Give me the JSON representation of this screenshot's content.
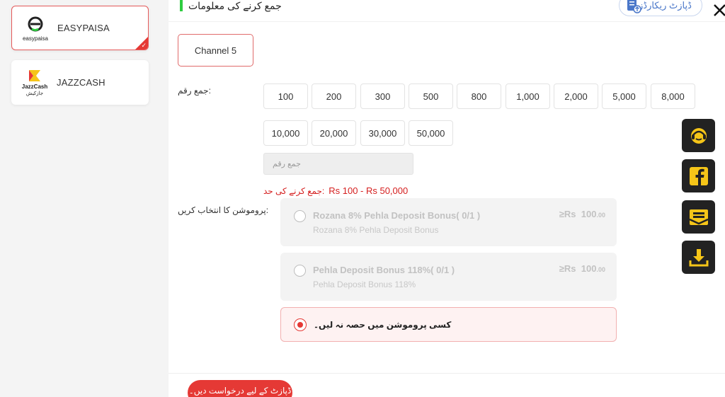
{
  "payment_methods": [
    {
      "name": "EASYPAISA",
      "logo_text": "easypaisa",
      "selected": true
    },
    {
      "name": "JAZZCASH",
      "logo_text": "JazzCash",
      "logo_subtext": "جازکیش",
      "selected": false
    }
  ],
  "header": {
    "title": "جمع کرنے کی معلومات",
    "accent_color": "#2ecc40"
  },
  "record_button": {
    "label": "ڈپازٹ ریکارڈز",
    "icon": "document-icon"
  },
  "close_icon": "close-icon",
  "channel": {
    "label": "Channel 5"
  },
  "amount": {
    "label": "جمع رقم:",
    "presets": [
      "100",
      "200",
      "300",
      "500",
      "800",
      "1,000",
      "2,000",
      "5,000",
      "8,000",
      "10,000",
      "20,000",
      "30,000",
      "50,000"
    ],
    "input_placeholder": "جمع رقم",
    "limit_label": "جمع کرنے کی حد:",
    "limit_value": "Rs  100  -  Rs  50,000"
  },
  "promotion": {
    "label": "پروموشن کا انتخاب کریں:",
    "options": [
      {
        "title": "Rozana 8% Pehla Deposit Bonus( 0/1 )",
        "subtitle": "Rozana 8% Pehla Deposit Bonus",
        "amount_prefix": "≥Rs",
        "amount": "100",
        "amount_decimal": ".00",
        "enabled": false
      },
      {
        "title": "Pehla Deposit Bonus 118%( 0/1 )",
        "subtitle": "Pehla Deposit Bonus 118%",
        "amount_prefix": "≥Rs",
        "amount": "100",
        "amount_decimal": ".00",
        "enabled": false
      }
    ],
    "none_option": {
      "label": "کسی پروموشن میں حصہ نہ لیں۔",
      "selected": true
    }
  },
  "side_icons": [
    "customer-service-icon",
    "facebook-icon",
    "mail-icon",
    "download-icon"
  ],
  "submit": {
    "label": "ڈپازٹ کے لیے درخواست دیں۔"
  },
  "colors": {
    "primary": "#e53935",
    "accent_green": "#2ecc40",
    "side_icon_yellow": "#f5c518"
  }
}
